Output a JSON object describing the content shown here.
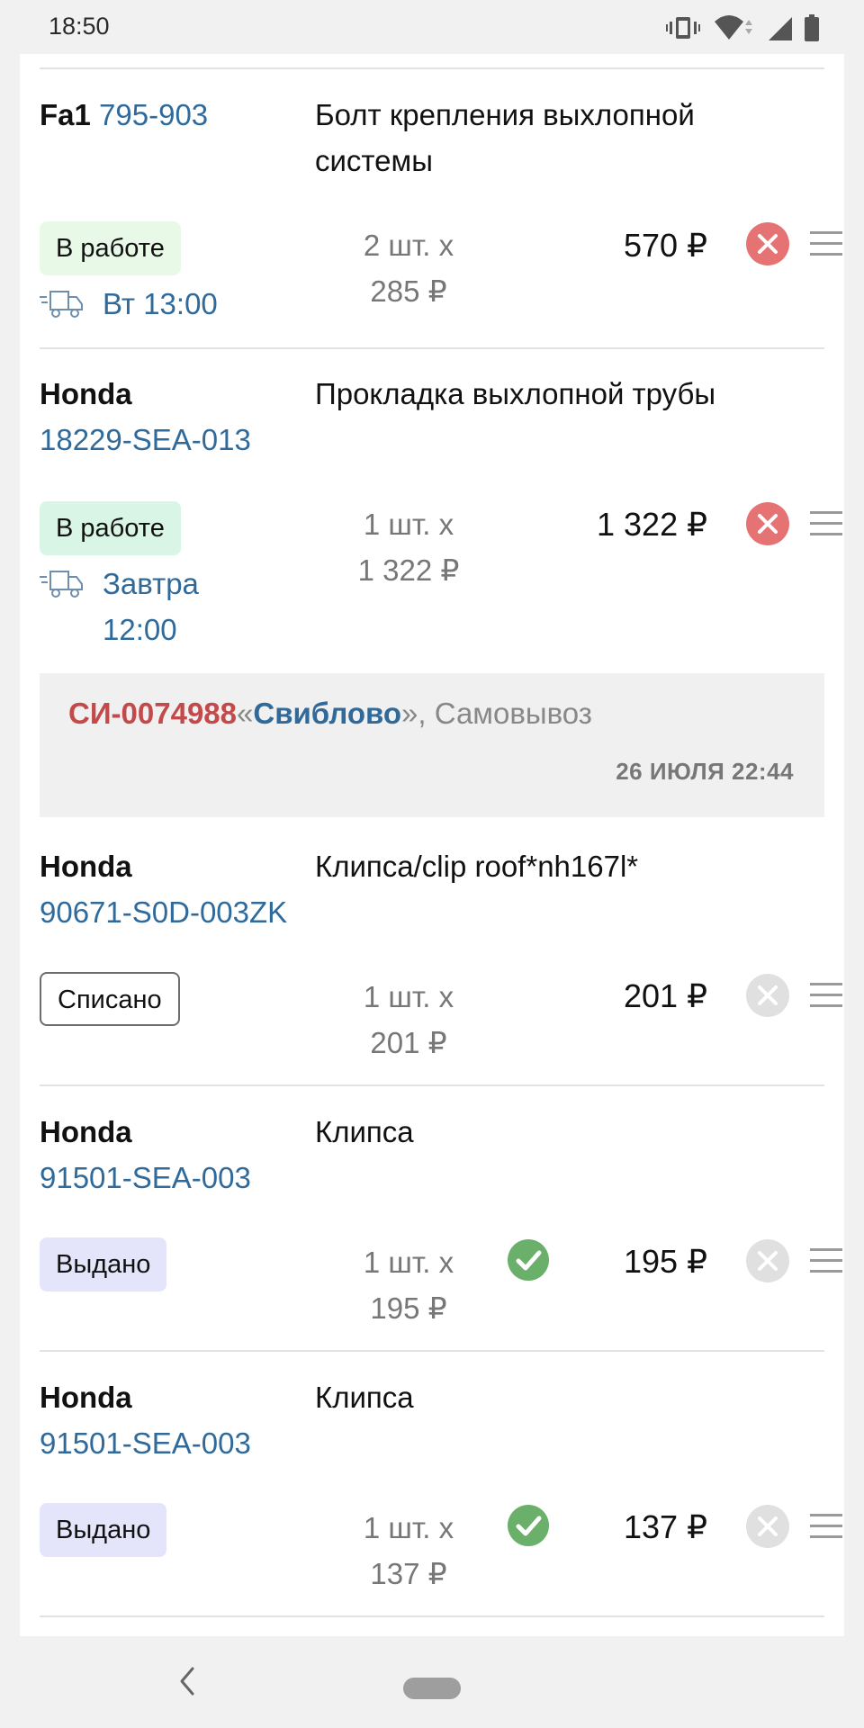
{
  "status_bar": {
    "time": "18:50",
    "icons": [
      "vibrate-icon",
      "wifi-icon",
      "signal-icon",
      "battery-icon"
    ]
  },
  "items": [
    {
      "brand": "Fa1",
      "part_number": "795-903",
      "description": "Болт крепления выхлопной системы",
      "status": "В работе",
      "delivery": "Вт 13:00",
      "quantity": "2 шт. x",
      "unit_price": "285 ₽",
      "price": "570 ₽",
      "delete_active": true
    },
    {
      "brand": "Honda",
      "part_number": "18229-SEA-013",
      "description": "Прокладка выхлопной трубы",
      "status": "В работе",
      "delivery_line1": "Завтра",
      "delivery_line2": "12:00",
      "quantity": "1 шт. x",
      "unit_price": "1 322 ₽",
      "price": "1 322 ₽",
      "delete_active": true
    }
  ],
  "order": {
    "number": "СИ-0074988",
    "quote_open": "«",
    "store": "Свиблово",
    "quote_close_suffix": "», Самовывоз",
    "date": "26 ИЮЛЯ 22:44"
  },
  "order_items": [
    {
      "brand": "Honda",
      "part_number": "90671-S0D-003ZK",
      "description": "Клипса/clip roof*nh167l*",
      "status": "Списано",
      "quantity": "1 шт. x",
      "unit_price": "201 ₽",
      "price": "201 ₽",
      "delete_active": false,
      "checked": false
    },
    {
      "brand": "Honda",
      "part_number": "91501-SEA-003",
      "description": "Клипса",
      "status": "Выдано",
      "quantity": "1 шт. x",
      "unit_price": "195 ₽",
      "price": "195 ₽",
      "delete_active": false,
      "checked": true
    },
    {
      "brand": "Honda",
      "part_number": "91501-SEA-003",
      "description": "Клипса",
      "status": "Выдано",
      "quantity": "1 шт. x",
      "unit_price": "137 ₽",
      "price": "137 ₽",
      "delete_active": false,
      "checked": true
    }
  ],
  "nav": {
    "icons": [
      "back-icon",
      "home-pill"
    ]
  },
  "colors": {
    "link": "#2f6a9a",
    "order_number": "#c24a4a",
    "delete_active": "#e57373",
    "delete_inactive": "#dddddd",
    "check": "#6aaf6a"
  }
}
